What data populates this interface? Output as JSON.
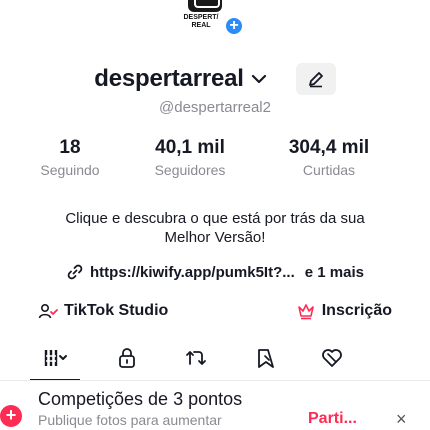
{
  "avatar": {
    "text_line1": "DESPERT/",
    "text_line2": "REAL",
    "add_icon": "plus-icon"
  },
  "profile": {
    "username": "despertarreal",
    "handle": "@despertarreal2",
    "chevron_icon": "chevron-down-icon",
    "edit_icon": "pencil-icon"
  },
  "stats": [
    {
      "value": "18",
      "label": "Seguindo"
    },
    {
      "value": "40,1 mil",
      "label": "Seguidores"
    },
    {
      "value": "304,4 mil",
      "label": "Curtidas"
    }
  ],
  "bio": {
    "line1": "Clique e descubra o que está por trás da sua",
    "line2": "Melhor Versão!"
  },
  "link": {
    "icon": "link-icon",
    "url": "https://kiwify.app/pumk5It?...",
    "more": "e 1 mais"
  },
  "buttons": [
    {
      "label": "TikTok Studio",
      "icon": "studio-icon"
    },
    {
      "label": "Inscrição",
      "icon": "subscription-icon"
    }
  ],
  "tabs": [
    {
      "name": "videos",
      "icon": "grid-icon",
      "active": true
    },
    {
      "name": "private",
      "icon": "lock-icon"
    },
    {
      "name": "reposts",
      "icon": "repost-icon"
    },
    {
      "name": "favorites",
      "icon": "bookmark-icon"
    },
    {
      "name": "liked",
      "icon": "heart-icon"
    }
  ],
  "promo": {
    "title": "Competições de 3 pontos",
    "subtitle": "Publique fotos para aumentar",
    "action": "Parti...",
    "close": "×"
  },
  "colors": {
    "accent": "#fe2c55",
    "blue": "#2b8cf5",
    "muted": "#8a8b91",
    "text": "#161823"
  }
}
